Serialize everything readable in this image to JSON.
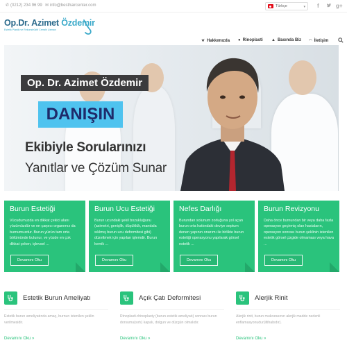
{
  "topbar": {
    "phone": "(0212) 234 96 99",
    "email": "info@besthaircenter.com",
    "language": "Türkçe",
    "social_icons": [
      "twitter-icon",
      "facebook-icon",
      "google-plus-icon"
    ]
  },
  "logo": {
    "name_first": "Op.Dr. Azimet",
    "name_last": "Özdemir",
    "subtitle": "Estetik Plastik ve Rekonstrüktif Cerrahi Uzmanı"
  },
  "nav": {
    "items": [
      {
        "label": "Hakkımızda",
        "icon": "leaf-icon"
      },
      {
        "label": "Rinoplasti",
        "icon": "user-icon"
      },
      {
        "label": "Basında Biz",
        "icon": "bell-icon"
      },
      {
        "label": "İletişim",
        "icon": "wifi-icon"
      }
    ]
  },
  "hero": {
    "title": "Op. Dr. Azimet Özdemir",
    "consult": "DANIŞIN",
    "line1": "Ekibiyle Sorularınızı",
    "line2": "Yanıtlar ve Çözüm Sunar"
  },
  "cards": [
    {
      "title": "Burun Estetiği",
      "text": "Vücudumuzda en dikkat çekici alanı yüzümüzdür ve en çarpıcı organımız da burnumuzdur.  Burun yüzün tam orta bölümünde bulunur, ve yüzde en çok dikkat çeken, işlevsel ...",
      "button": "Devamını Oku"
    },
    {
      "title": "Burun Ucu Estetiği",
      "text": "Burun ucundaki şekil bozukluğunu (asimetri, genişlik, düşüklük, mandala sıklmış burun ucu deformitesi gibi) düzeltmek için yapılan işlemdir. Burun kemik ...",
      "button": "Devamını Oku"
    },
    {
      "title": "Nefes Darlığı",
      "text": "Burundan solunum zorluğuna yol açan burun orta hattındaki deviye septum denen yapının onarımı ile birlikte burun estetiği operasyonu yapılarak görsel estetik  ...",
      "button": "Devamını Oku"
    },
    {
      "title": "Burun Revizyonu",
      "text": "Daha önce burnundan bir veya daha fazla operasyon geçirmiş olan hastaların, operasyon sonrası burun şeklinin istenilen estetik görsel çizgide olmaması veya hava ...",
      "button": "Devamını Oku"
    }
  ],
  "features": [
    {
      "title": "Estetik Burun Ameliyatı",
      "text": "Estetik burun ameliyatında amaç, burnun istenilen şeklin verilmesidir.",
      "link": "Devamını Oku »",
      "icon": "stethoscope-icon"
    },
    {
      "title": "Açık Çatı Deformitesi",
      "text": "Rinoplasti-rhinoplasty (burun estetik ameliyatı) sonrası burun dorsumu(sırtı) kapalı, dolgun ve düzgün olmalıdır.",
      "link": "Devamını Oku »",
      "icon": "stethoscope-icon"
    },
    {
      "title": "Alerjik Rinit",
      "text": "Alerjik rinit, burun mukozasının alerjik madde nedenli enflamasyonudur(iltihabıdır).",
      "link": "Devamını Oku »",
      "icon": "stethoscope-icon"
    }
  ],
  "colors": {
    "green": "#2ac37c",
    "logo_blue": "#2b6a8c",
    "accent_blue": "#4fc3ef"
  }
}
